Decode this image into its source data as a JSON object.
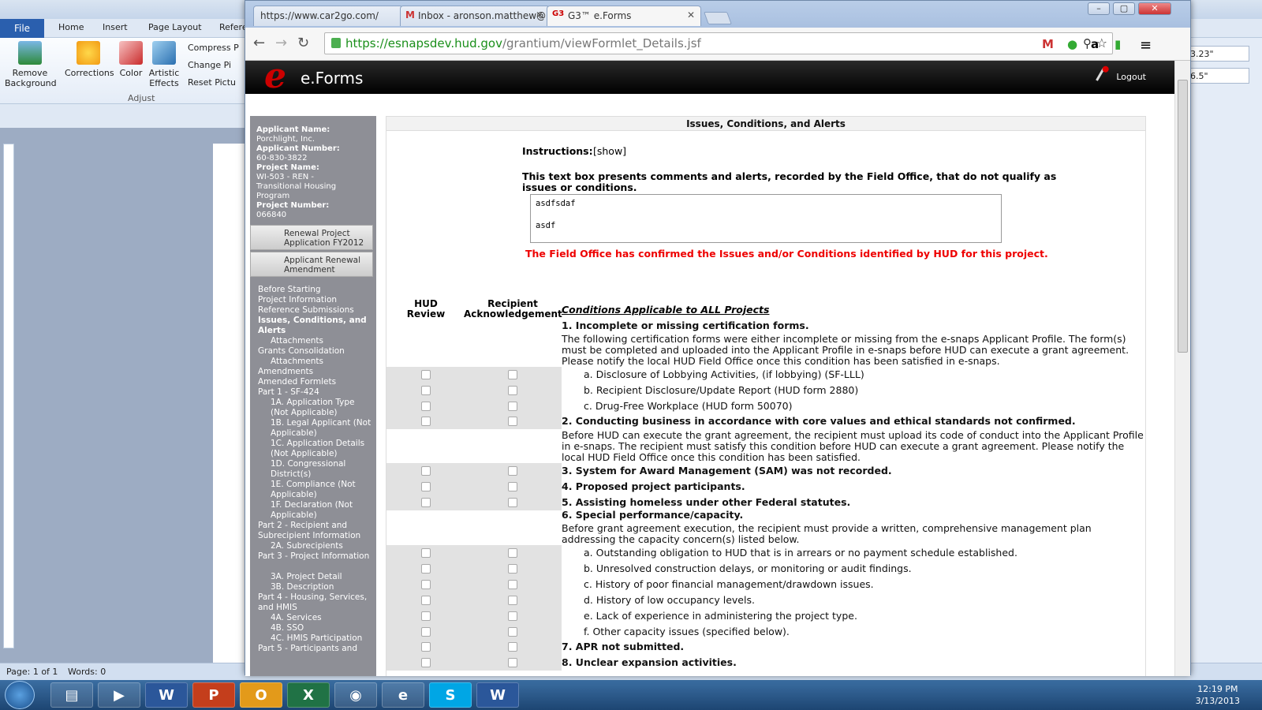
{
  "word": {
    "tabs": [
      "File",
      "Home",
      "Insert",
      "Page Layout",
      "Refere"
    ],
    "ribbon": {
      "remove_background": "Remove\nBackground",
      "corrections": "Corrections",
      "color": "Color",
      "artistic_effects": "Artistic\nEffects",
      "compress": "Compress P",
      "change": "Change Pi",
      "reset": "Reset Pictu",
      "group_label": "Adjust",
      "size1": "3.23\"",
      "size2": "6.5\""
    },
    "status": {
      "page": "Page: 1 of 1",
      "words": "Words: 0"
    }
  },
  "taskbar": {
    "time": "12:19 PM",
    "date": "3/13/2013"
  },
  "browser": {
    "tabs": [
      {
        "label": "https://www.car2go.com/"
      },
      {
        "label": "Inbox - aronson.matthew@"
      },
      {
        "label": "G3™ e.Forms"
      }
    ],
    "url_scheme": "https://",
    "url_host": "esnapsdev.hud.gov",
    "url_path": "/grantium/viewFormlet_Details.jsf"
  },
  "app": {
    "title": "e.Forms",
    "logo": "e",
    "logout": "Logout"
  },
  "sidebar": {
    "applicant_name_label": "Applicant Name:",
    "applicant_name": "Porchlight, Inc.",
    "applicant_number_label": "Applicant Number:",
    "applicant_number": "60-830-3822",
    "project_name_label": "Project Name:",
    "project_name": "WI-503 - REN -\nTransitional Housing\nProgram",
    "project_number_label": "Project Number:",
    "project_number": "066840",
    "buttons": [
      "Renewal Project\nApplication FY2012",
      "Applicant Renewal\nAmendment"
    ],
    "nav": [
      "Before Starting",
      "Project Information",
      "Reference Submissions",
      "Issues, Conditions, and Alerts",
      "Attachments",
      "Grants Consolidation",
      "Attachments",
      "Amendments",
      "Amended Formlets",
      "Part 1 - SF-424",
      "1A. Application Type (Not Applicable)",
      "1B. Legal Applicant (Not Applicable)",
      "1C. Application Details (Not Applicable)",
      "1D. Congressional District(s)",
      "1E. Compliance (Not Applicable)",
      "1F. Declaration (Not Applicable)",
      "Part 2 - Recipient and Subrecipient Information",
      "2A. Subrecipients",
      "Part 3 - Project Information",
      "3A. Project Detail",
      "3B. Description",
      "Part 4 - Housing, Services, and HMIS",
      "4A. Services",
      "4B. SSO",
      "4C. HMIS Participation",
      "Part 5 - Participants and"
    ]
  },
  "main": {
    "header": "Issues, Conditions, and Alerts",
    "instructions_label": "Instructions:",
    "instructions_toggle": "[show]",
    "textbox_label": "This text box presents comments and alerts, recorded by the Field Office, that do not qualify as\nissues or conditions.",
    "textbox_value": "asdfsdaf\n\nasdf",
    "confirm": "The Field Office has confirmed the Issues and/or Conditions identified by HUD for this project.",
    "col_hud": "HUD\nReview",
    "col_recipient": "Recipient\nAcknowledgement",
    "conditions_title": "Conditions Applicable to ALL Projects",
    "c1": "1. Incomplete or missing certification forms.",
    "c1_desc": "The following certification forms were either incomplete or missing from the e-snaps Applicant Profile. The form(s) must be completed and uploaded into the Applicant Profile in e-snaps before HUD can execute a grant agreement. Please notify the local HUD Field Office once this condition has been satisfied in e-snaps.",
    "c1a": "a. Disclosure of Lobbying Activities, (if lobbying) (SF-LLL)",
    "c1b": "b. Recipient Disclosure/Update Report (HUD form 2880)",
    "c1c": "c. Drug-Free Workplace (HUD form 50070)",
    "c2": "2. Conducting business in accordance with core values and ethical standards not confirmed.",
    "c2_desc": "Before HUD can execute the grant agreement, the recipient must upload its code of conduct into the Applicant Profile in e-snaps. The recipient must satisfy this condition before HUD can execute a grant agreement. Please notify the local HUD Field Office once this condition has been satisfied.",
    "c3": "3. System for Award Management (SAM) was not recorded.",
    "c4": "4. Proposed project participants.",
    "c5": "5. Assisting homeless under other Federal statutes.",
    "c6": "6. Special performance/capacity.",
    "c6_desc": "Before grant agreement execution, the recipient must provide a written, comprehensive management plan addressing the capacity concern(s) listed below.",
    "c6a": "a. Outstanding obligation to HUD that is in arrears or no payment schedule established.",
    "c6b": "b. Unresolved construction delays, or monitoring or audit findings.",
    "c6c": "c. History of poor financial management/drawdown issues.",
    "c6d": "d. History of low occupancy levels.",
    "c6e": "e. Lack of experience in administering the project type.",
    "c6f": "f. Other capacity issues (specified below).",
    "c7": "7. APR not submitted.",
    "c8": "8. Unclear expansion activities."
  }
}
